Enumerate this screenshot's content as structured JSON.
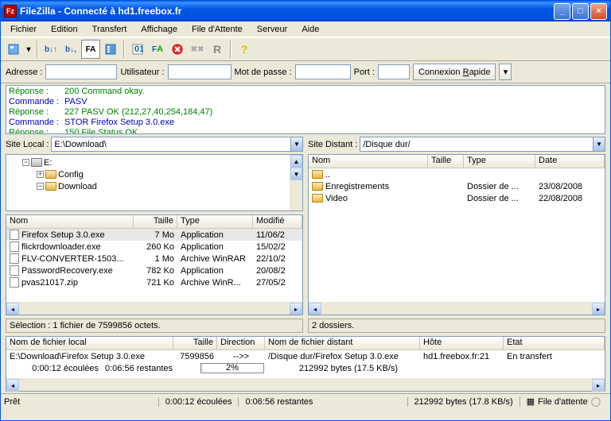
{
  "window": {
    "title": "FileZilla - Connecté à hd1.freebox.fr"
  },
  "menu": {
    "fichier": "Fichier",
    "edition": "Edition",
    "transfert": "Transfert",
    "affichage": "Affichage",
    "file_attente": "File d'Attente",
    "serveur": "Serveur",
    "aide": "Aide"
  },
  "quick": {
    "adresse_label": "Adresse :",
    "adresse": "",
    "utilisateur_label": "Utilisateur :",
    "utilisateur": "",
    "motdepasse_label": "Mot de passe :",
    "motdepasse": "",
    "port_label": "Port :",
    "port": "",
    "connexion": "Connexion Rapide"
  },
  "log": [
    {
      "cls": "log-green",
      "label": "Réponse :",
      "text": "200 Command okay."
    },
    {
      "cls": "log-blue",
      "label": "Commande :",
      "text": "PASV"
    },
    {
      "cls": "log-green",
      "label": "Réponse :",
      "text": "227 PASV OK (212,27,40,254,184,47)"
    },
    {
      "cls": "log-blue",
      "label": "Commande :",
      "text": "STOR Firefox Setup 3.0.exe"
    },
    {
      "cls": "log-green",
      "label": "Réponse :",
      "text": "150 File Status OK."
    }
  ],
  "local": {
    "label": "Site Local :",
    "path": "E:\\Download\\",
    "tree": [
      {
        "indent": 18,
        "box": "−",
        "type": "drive",
        "name": "E:"
      },
      {
        "indent": 36,
        "box": "+",
        "type": "folder",
        "name": "Config"
      },
      {
        "indent": 36,
        "box": "−",
        "type": "folder",
        "name": "Download"
      }
    ],
    "cols": {
      "nom": "Nom",
      "taille": "Taille",
      "type": "Type",
      "modifie": "Modifié"
    },
    "files": [
      {
        "sel": true,
        "name": "Firefox Setup 3.0.exe",
        "size": "7 Mo",
        "type": "Application",
        "date": "11/06/2"
      },
      {
        "sel": false,
        "name": "flickrdownloader.exe",
        "size": "260 Ko",
        "type": "Application",
        "date": "15/02/2"
      },
      {
        "sel": false,
        "name": "FLV-CONVERTER-1503...",
        "size": "1 Mo",
        "type": "Archive WinRAR",
        "date": "22/10/2"
      },
      {
        "sel": false,
        "name": "PasswordRecovery.exe",
        "size": "782 Ko",
        "type": "Application",
        "date": "20/08/2"
      },
      {
        "sel": false,
        "name": "pvas21017.zip",
        "size": "721 Ko",
        "type": "Archive WinR...",
        "date": "27/05/2"
      }
    ],
    "status": "Sélection : 1 fichier de 7599856 octets."
  },
  "remote": {
    "label": "Site Distant :",
    "path": "/Disque dur/",
    "cols": {
      "nom": "Nom",
      "taille": "Taille",
      "type": "Type",
      "date": "Date"
    },
    "rows": [
      {
        "icon": "up",
        "name": "..",
        "size": "",
        "type": "",
        "date": ""
      },
      {
        "icon": "folder",
        "name": "Enregistrements",
        "size": "",
        "type": "Dossier de ...",
        "date": "23/08/2008"
      },
      {
        "icon": "folder",
        "name": "Video",
        "size": "",
        "type": "Dossier de ...",
        "date": "22/08/2008"
      }
    ],
    "status": "2 dossiers."
  },
  "queue": {
    "cols": {
      "local": "Nom de fichier local",
      "taille": "Taille",
      "direction": "Direction",
      "distant": "Nom de fichier distant",
      "hote": "Hôte",
      "etat": "Etat"
    },
    "row": {
      "local": "E:\\Download\\Firefox Setup 3.0.exe",
      "taille": "7599856",
      "direction": "-->>",
      "distant": "/Disque dur/Firefox Setup 3.0.exe",
      "hote": "hd1.freebox.fr:21",
      "etat": "En transfert"
    },
    "subline": {
      "ecoulees": "0:00:12 écoulées",
      "restantes": "0:06:56 restantes",
      "progress": "2%",
      "bytes": "212992 bytes (17.5 KB/s)"
    },
    "tab": "File d'attente"
  },
  "status": {
    "pret": "Prêt",
    "ecoulees": "0:00:12 écoulées",
    "restantes": "0:06:56 restantes",
    "bytes": "212992 bytes (17.8 KB/s)"
  }
}
